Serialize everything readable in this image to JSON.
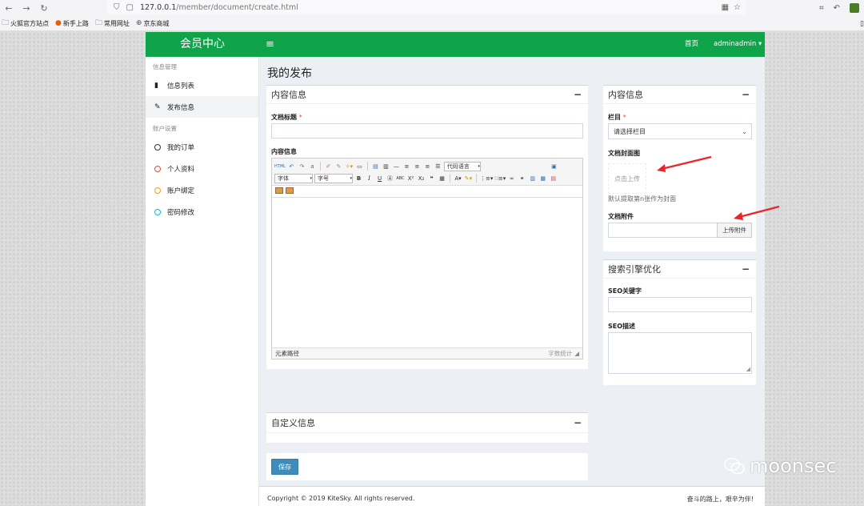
{
  "browser": {
    "url_host": "127.0.0.1",
    "url_path": "/member/document/create.html",
    "bookmarks": [
      "火狐官方站点",
      "新手上路",
      "常用网址",
      "京东商城"
    ]
  },
  "topnav": {
    "brand": "会员中心",
    "home": "首页",
    "user": "adminadmin ▾",
    "color": "#10a44a"
  },
  "sidebar": {
    "section1": "信息管理",
    "section2": "账户设置",
    "items": [
      {
        "label": "信息列表",
        "icon": "book-icon"
      },
      {
        "label": "发布信息",
        "icon": "edit-icon"
      },
      {
        "label": "我的订单",
        "icon": "circle-dark-icon",
        "color": "#333333"
      },
      {
        "label": "个人资料",
        "icon": "circle-red-icon",
        "color": "#dd4b39"
      },
      {
        "label": "账户绑定",
        "icon": "circle-yellow-icon",
        "color": "#f39c12"
      },
      {
        "label": "密码修改",
        "icon": "circle-aqua-icon",
        "color": "#00c0ef"
      }
    ]
  },
  "main": {
    "page_title": "我的发布",
    "content_box": {
      "title": "内容信息",
      "title_label": "文档标题",
      "content_label": "内容信息",
      "editor": {
        "font_family": "字体",
        "font_size": "字号",
        "code_lang": "代码语言",
        "path_label": "元素路径",
        "word_count": "字数统计"
      }
    },
    "custom_box": {
      "title": "自定义信息"
    },
    "save_button": "保存"
  },
  "right": {
    "info_box": {
      "title": "内容信息",
      "column_label": "栏目",
      "column_selected": "请选择栏目",
      "cover_label": "文档封面图",
      "cover_upload": "点击上传",
      "cover_hint": "默认提取第n张作为封面",
      "attach_label": "文档附件",
      "attach_button": "上传附件"
    },
    "seo_box": {
      "title": "搜索引擎优化",
      "keywords_label": "SEO关键字",
      "desc_label": "SEO描述"
    }
  },
  "footer": {
    "copyright": "Copyright © 2019 KiteSky. All rights reserved.",
    "slogan": "奋斗的路上，艰辛为伴!"
  },
  "watermark": "moonsec",
  "colors": {
    "arrow": "#e8262b",
    "save": "#3c8dbc"
  }
}
